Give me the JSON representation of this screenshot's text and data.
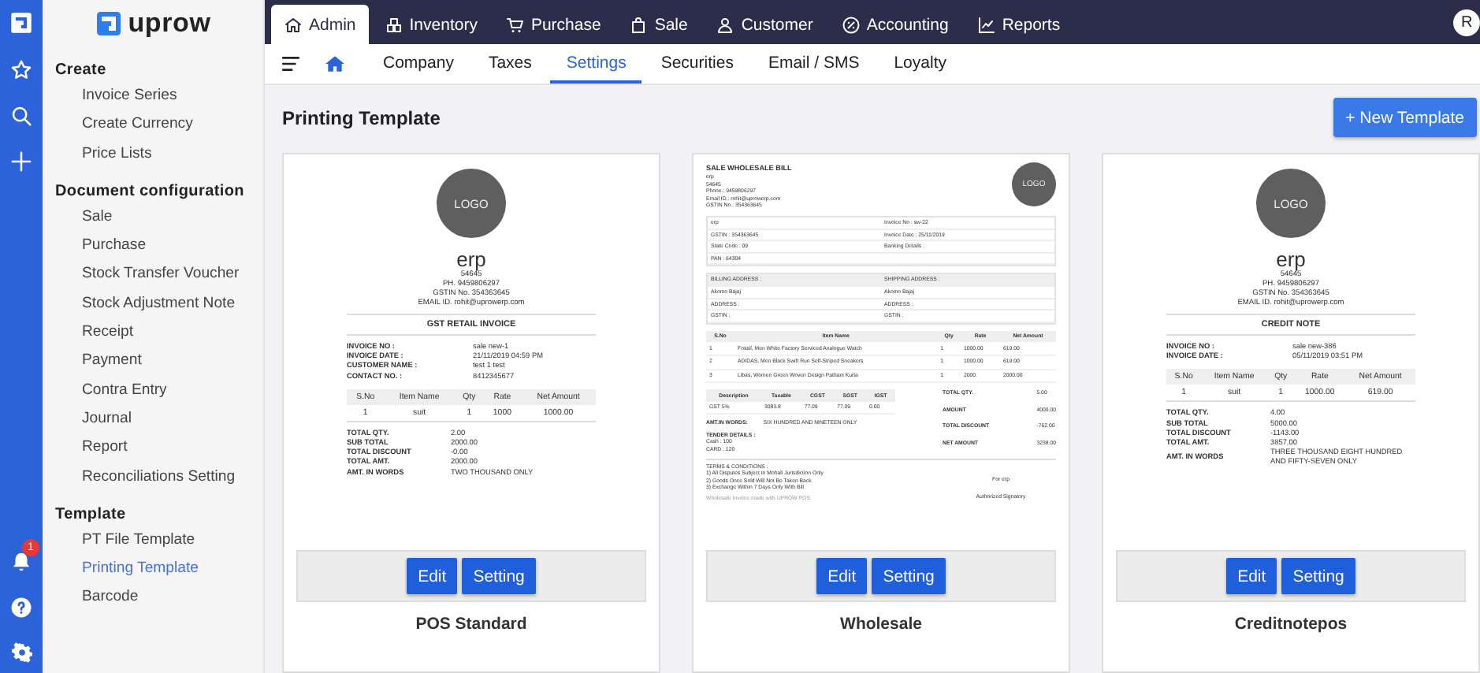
{
  "rail": {
    "badge": "1"
  },
  "sidebar": {
    "logo": "uprow",
    "sections": [
      {
        "title": "Create",
        "items": [
          {
            "label": "Invoice Series",
            "selected": false
          },
          {
            "label": "Create Currency",
            "selected": false
          },
          {
            "label": "Price Lists",
            "selected": false
          }
        ]
      },
      {
        "title": "Document configuration",
        "items": [
          {
            "label": "Sale",
            "selected": false
          },
          {
            "label": "Purchase",
            "selected": false
          },
          {
            "label": "Stock Transfer Voucher",
            "selected": false
          },
          {
            "label": "Stock Adjustment Note",
            "selected": false
          },
          {
            "label": "Receipt",
            "selected": false
          },
          {
            "label": "Payment",
            "selected": false
          },
          {
            "label": "Contra Entry",
            "selected": false
          },
          {
            "label": "Journal",
            "selected": false
          },
          {
            "label": "Report",
            "selected": false
          },
          {
            "label": "Reconciliations Setting",
            "selected": false
          }
        ]
      },
      {
        "title": "Template",
        "items": [
          {
            "label": "PT File Template",
            "selected": false
          },
          {
            "label": "Printing Template",
            "selected": true
          },
          {
            "label": "Barcode",
            "selected": false
          }
        ]
      }
    ]
  },
  "main_tabs": [
    {
      "label": "Admin",
      "selected": true
    },
    {
      "label": "Inventory",
      "selected": false
    },
    {
      "label": "Purchase",
      "selected": false
    },
    {
      "label": "Sale",
      "selected": false
    },
    {
      "label": "Customer",
      "selected": false
    },
    {
      "label": "Accounting",
      "selected": false
    },
    {
      "label": "Reports",
      "selected": false
    }
  ],
  "avatar": "R",
  "sub_tabs": [
    {
      "label": "Company",
      "selected": false
    },
    {
      "label": "Taxes",
      "selected": false
    },
    {
      "label": "Settings",
      "selected": true
    },
    {
      "label": "Securities",
      "selected": false
    },
    {
      "label": "Email / SMS",
      "selected": false
    },
    {
      "label": "Loyalty",
      "selected": false
    }
  ],
  "page": {
    "title": "Printing Template",
    "new_button": "+ New Template"
  },
  "templates": [
    {
      "kind": "receipt",
      "name": "POS Standard",
      "buttons": [
        "Edit",
        "Setting"
      ],
      "preview": {
        "logo": "LOGO",
        "company": "erp",
        "details": [
          "54645",
          "PH. 9459806297",
          "GSTIN No. 354363645",
          "EMAIL ID. rohit@uprowerp.com"
        ],
        "doc_title": "GST RETAIL INVOICE",
        "info": [
          [
            "INVOICE NO :",
            "sale new-1"
          ],
          [
            "INVOICE DATE :",
            "21/11/2019 04:59 PM"
          ],
          [
            "CUSTOMER NAME :",
            "test 1 test"
          ],
          [
            "CONTACT NO. :",
            "8412345677"
          ]
        ],
        "table": {
          "columns": [
            "S.No",
            "Item Name",
            "Qty",
            "Rate",
            "Net Amount"
          ],
          "rows": [
            [
              "1",
              "suit",
              "1",
              "1000",
              "1000.00"
            ]
          ]
        },
        "totals": [
          [
            "TOTAL QTY.",
            "2.00"
          ],
          [
            "SUB TOTAL",
            "2000.00"
          ],
          [
            "TOTAL DISCOUNT",
            "-0.00"
          ],
          [
            "TOTAL AMT.",
            "2000.00"
          ],
          [
            "AMT. IN WORDS",
            "TWO THOUSAND ONLY"
          ]
        ]
      }
    },
    {
      "kind": "bill",
      "name": "Wholesale",
      "buttons": [
        "Edit",
        "Setting"
      ],
      "preview": {
        "title": "SALE WHOLESALE BILL",
        "logo": "LOGO",
        "details": [
          "erp",
          "54645",
          "Phone.: 9459806297",
          "Email ID.: rohit@uprowerp.com",
          "GSTIN No.: 354363645"
        ],
        "info": [
          [
            "erp",
            "Invoice No : sw-22"
          ],
          [
            "GSTIN : 354363645",
            "Invoice Date : 25/11/2019"
          ],
          [
            "State Code : 09",
            "Banking Details :"
          ],
          [
            "PAN : 64304"
          ]
        ],
        "address_head": [
          "BILLING ADDRESS :",
          "SHIPPING ADDRESS :"
        ],
        "address": [
          [
            "Akomo Bajaj",
            "Akomo Bajaj"
          ],
          [
            "ADDRESS :",
            "ADDRESS :"
          ],
          [
            "GSTIN :",
            "GSTIN :"
          ]
        ],
        "items": {
          "columns": [
            "S.No",
            "Item Name",
            "Qty",
            "Rate",
            "Net Amount"
          ],
          "rows": [
            [
              "1",
              "Fossil, Men White Factory Serviced Analogue Watch",
              "1",
              "1000.00",
              "619.00"
            ],
            [
              "2",
              "ADIDAS, Men Black Swift Run Self-Striped Sneakers",
              "1",
              "1000.00",
              "619.00"
            ],
            [
              "3",
              "Libas, Women Green Woven Design Pathani Kurta",
              "1",
              "2000",
              "2000.00"
            ]
          ]
        },
        "tax": {
          "columns": [
            "Description",
            "Taxable",
            "CGST",
            "SGST",
            "IGST"
          ],
          "rows": [
            [
              "GST 5%",
              "3083.8",
              "77.09",
              "77.09",
              "0.00"
            ]
          ]
        },
        "totals": [
          [
            "TOTAL QTY.",
            "5.00"
          ],
          [
            "AMOUNT",
            "4000.00"
          ],
          [
            "TOTAL DISCOUNT",
            "-762.00"
          ],
          [
            "NET AMOUNT",
            "3238.00"
          ]
        ],
        "words": [
          "AMT.IN WORDS:",
          "SIX HUNDRED AND NINETEEN ONLY"
        ],
        "tender": [
          "TENDER DETAILS :",
          "Cash : 100",
          "CARD : 120"
        ],
        "terms": [
          "TERMS & CONDITIONS :",
          "1) All Disputes Subject to Mohali Jurisdiction Only",
          "2) Goods Once Sold Will Not Be Taken Back",
          "3) Exchange Within 7 Days Only With Bill"
        ],
        "sign": [
          "For erp",
          "Authorized Signatory"
        ],
        "footer": "Wholesale Invoice made with UPROW POS"
      }
    },
    {
      "kind": "receipt",
      "name": "Creditnotepos",
      "buttons": [
        "Edit",
        "Setting"
      ],
      "preview": {
        "logo": "LOGO",
        "company": "erp",
        "details": [
          "54645",
          "PH. 9459806297",
          "GSTIN No. 354363645",
          "EMAIL ID. rohit@uprowerp.com"
        ],
        "doc_title": "CREDIT NOTE",
        "info": [
          [
            "INVOICE NO :",
            "sale new-386"
          ],
          [
            "INVOICE DATE :",
            "05/11/2019 03:51 PM"
          ]
        ],
        "table": {
          "columns": [
            "S.No",
            "Item Name",
            "Qty",
            "Rate",
            "Net Amount"
          ],
          "rows": [
            [
              "1",
              "suit",
              "1",
              "1000.00",
              "619.00"
            ]
          ]
        },
        "totals": [
          [
            "TOTAL QTY.",
            "4.00"
          ],
          [
            "SUB TOTAL",
            "5000.00"
          ],
          [
            "TOTAL DISCOUNT",
            "-1143.00"
          ],
          [
            "TOTAL AMT.",
            "3857.00"
          ],
          [
            "AMT. IN WORDS",
            "THREE THOUSAND EIGHT HUNDRED AND FIFTY-SEVEN ONLY"
          ]
        ]
      }
    }
  ]
}
